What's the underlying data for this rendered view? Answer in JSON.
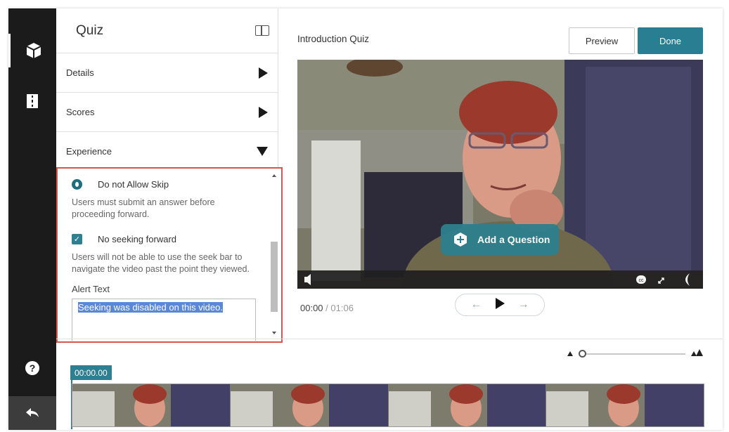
{
  "sidebar": {
    "title": "Quiz",
    "sections": [
      {
        "label": "Details",
        "state": "collapsed"
      },
      {
        "label": "Scores",
        "state": "collapsed"
      },
      {
        "label": "Experience",
        "state": "expanded"
      }
    ],
    "experience": {
      "option_no_skip_label": "Do not Allow Skip",
      "option_no_skip_help": "Users must submit an answer before proceeding forward.",
      "option_no_seek_label": "No seeking forward",
      "option_no_seek_checked": true,
      "option_no_seek_help": "Users will not be able to use the seek bar to navigate the video past the point they viewed.",
      "alert_text_label": "Alert Text",
      "alert_text_value": "Seeking was disabled on this video."
    }
  },
  "header": {
    "title": "Introduction Quiz",
    "preview_label": "Preview",
    "done_label": "Done"
  },
  "player": {
    "add_question_label": "Add a Question",
    "current_time": "00:00",
    "separator": " / ",
    "duration": "01:06"
  },
  "timeline": {
    "timecode": "00:00.00"
  },
  "colors": {
    "accent": "#2a7e92",
    "highlight_border": "#d9534f",
    "rail": "#1b1b1b"
  },
  "icons": {
    "rail_top": "cube-icon",
    "rail_second": "film-icon",
    "rail_help": "help-icon",
    "rail_back": "back-arrow-icon"
  }
}
